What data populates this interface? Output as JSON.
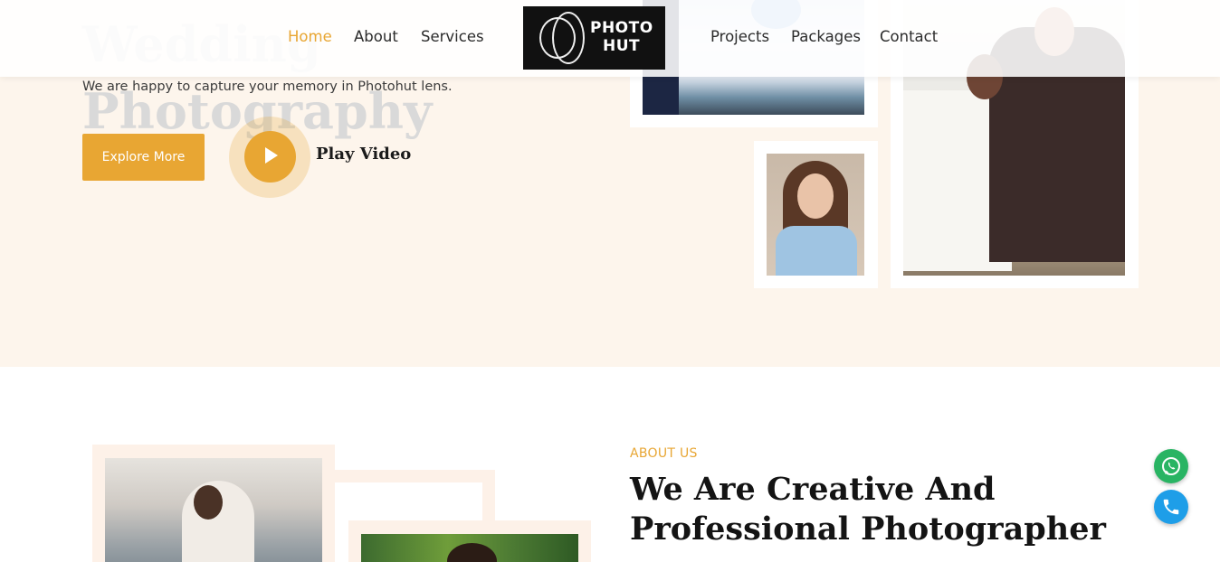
{
  "hero": {
    "title": "Best Pre & Post Wedding Photography",
    "subtitle": "We are happy to capture your memory in Photohut lens.",
    "explore_label": "Explore More",
    "play_label": "Play Video"
  },
  "nav": {
    "items_left": [
      "Home",
      "About",
      "Services"
    ],
    "items_right": [
      "Projects",
      "Packages",
      "Contact"
    ],
    "active": "Home",
    "logo_line1": "PHOTO",
    "logo_line2": "HUT"
  },
  "about": {
    "tag": "ABOUT US",
    "title": "We Are Creative And Professional Photographer"
  },
  "floating": {
    "whatsapp_icon": "whatsapp-icon",
    "phone_icon": "phone-icon"
  },
  "colors": {
    "accent": "#e8a633",
    "hero_bg": "#fdf5ec",
    "whatsapp": "#29b463",
    "phone": "#1e9ee8"
  }
}
